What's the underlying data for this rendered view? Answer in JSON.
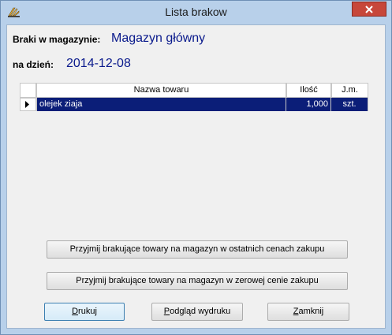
{
  "window": {
    "title": "Lista brakow"
  },
  "header": {
    "warehouse_label": "Braki w magazynie:",
    "warehouse_value": "Magazyn główny",
    "date_label": "na dzień:",
    "date_value": "2014-12-08"
  },
  "table": {
    "columns": [
      "Nazwa towaru",
      "Ilość",
      "J.m."
    ],
    "rows": [
      {
        "name": "olejek ziaja",
        "qty": "1,000",
        "unit": "szt."
      }
    ]
  },
  "actions": {
    "accept_last_price": "Przyjmij brakujące towary na magazyn w ostatnich cenach zakupu",
    "accept_zero_price": "Przyjmij brakujące towary na magazyn w zerowej cenie zakupu"
  },
  "footer": {
    "print_first": "D",
    "print_rest": "rukuj",
    "preview_first": "P",
    "preview_rest": "odgląd wydruku",
    "close_first": "Z",
    "close_rest": "amknij"
  }
}
